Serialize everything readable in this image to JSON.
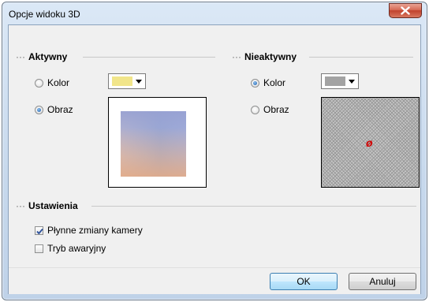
{
  "window": {
    "title": "Opcje widoku 3D"
  },
  "active": {
    "header": "Aktywny",
    "color_label": "Kolor",
    "image_label": "Obraz",
    "color_swatch": "#f1e58a",
    "selected": "image"
  },
  "inactive": {
    "header": "Nieaktywny",
    "color_label": "Kolor",
    "image_label": "Obraz",
    "color_swatch": "#a3a3a3",
    "selected": "color",
    "none_symbol": "ø"
  },
  "settings": {
    "header": "Ustawienia",
    "smooth_camera_label": "Płynne zmiany kamery",
    "smooth_camera_checked": true,
    "safe_mode_label": "Tryb awaryjny",
    "safe_mode_checked": false
  },
  "buttons": {
    "ok": "OK",
    "cancel": "Anuluj"
  },
  "header_dots": "···"
}
